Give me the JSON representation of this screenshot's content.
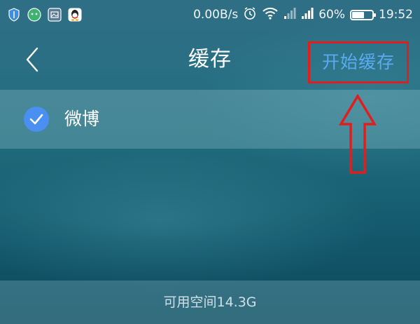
{
  "status_bar": {
    "notification_icons": [
      "shield-icon",
      "wechat-icon",
      "gallery-icon",
      "qq-icon"
    ],
    "network_speed": "0.00B/s",
    "battery_percent": "60%",
    "battery_level": 0.6,
    "time": "19:52"
  },
  "header": {
    "title": "缓存",
    "start_cache_label": "开始缓存"
  },
  "list": {
    "items": [
      {
        "label": "微博",
        "checked": true
      }
    ]
  },
  "footer": {
    "storage_text": "可用空间14.3G"
  },
  "colors": {
    "accent_blue": "#4a8ff2",
    "link_blue": "#5aaaf0",
    "annotation_red": "#e01e1e"
  }
}
